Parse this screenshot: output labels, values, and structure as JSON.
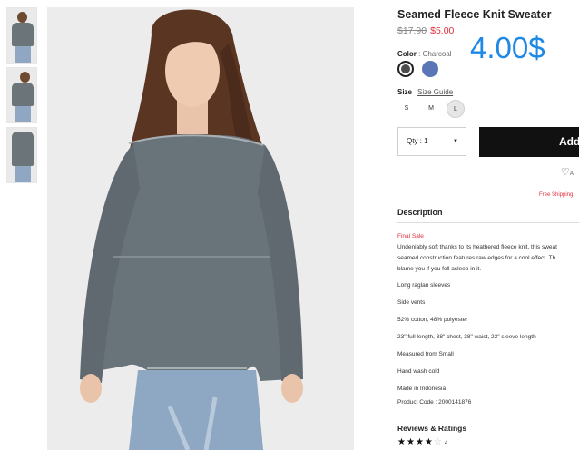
{
  "product": {
    "title": "Seamed Fleece Knit Sweater",
    "price_old": "$17.90",
    "price_new": "$5.00",
    "overlay_price": "4.00$"
  },
  "color": {
    "label": "Color",
    "separator": " : ",
    "value": "Charcoal",
    "swatches": [
      {
        "name": "charcoal",
        "hex": "#4d4d4d"
      },
      {
        "name": "blue",
        "hex": "#5a76b6"
      }
    ]
  },
  "size": {
    "label": "Size",
    "guide": "Size Guide",
    "options": [
      "S",
      "M",
      "L"
    ],
    "selected": "L"
  },
  "quantity": {
    "label": "Qty : 1"
  },
  "cart": {
    "add_label": "Add"
  },
  "wishlist": {
    "label": "A"
  },
  "shipping": {
    "text": "Free Shipping"
  },
  "description": {
    "heading": "Description",
    "final_sale": "Final Sale",
    "body_lines": [
      "Undeniably soft thanks to its heathered fleece knit, this sweat",
      "seamed construction features raw edges for a cool effect. Th",
      "blame you if you fell asleep in it."
    ],
    "features": [
      "Long raglan sleeves",
      "Side vents",
      "52% cotton, 48% polyester",
      "23\" full length, 38\" chest, 38\" waist, 23\" sleeve length",
      "Measured from Small",
      "Hand wash cold",
      "Made in Indonesia",
      "Product Code : 2000141876"
    ]
  },
  "reviews": {
    "heading": "Reviews & Ratings",
    "rating": 4,
    "max": 5,
    "count": "4"
  },
  "colors": {
    "sale": "#e2303b",
    "overlay": "#1e88e5",
    "button": "#111111"
  }
}
